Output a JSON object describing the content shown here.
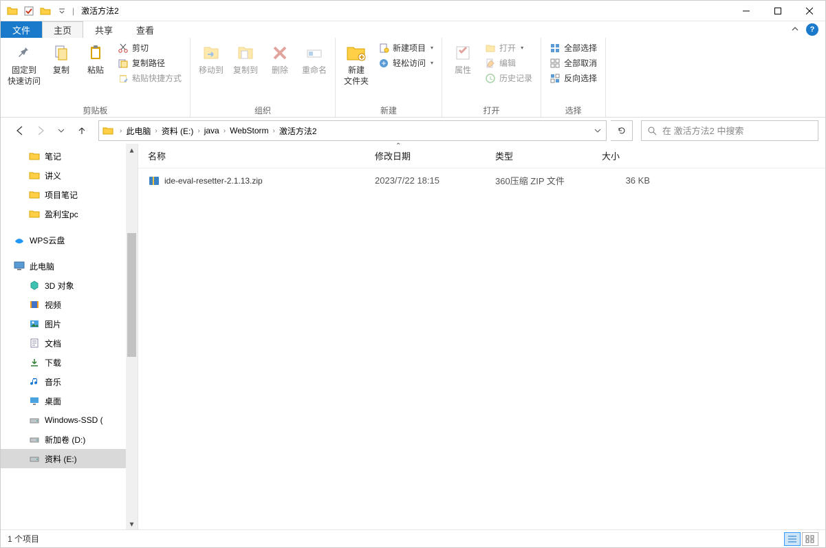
{
  "window": {
    "title": "激活方法2"
  },
  "tabs": {
    "file": "文件",
    "home": "主页",
    "share": "共享",
    "view": "查看"
  },
  "ribbon": {
    "clipboard": {
      "label": "剪贴板",
      "pin1": "固定到",
      "pin2": "快速访问",
      "copy": "复制",
      "paste": "粘贴",
      "cut": "剪切",
      "copypath": "复制路径",
      "pasteshort": "粘贴快捷方式"
    },
    "organize": {
      "label": "组织",
      "moveto": "移动到",
      "copyto": "复制到",
      "delete": "删除",
      "rename": "重命名"
    },
    "new": {
      "label": "新建",
      "folder1": "新建",
      "folder2": "文件夹",
      "newitem": "新建项目",
      "easyaccess": "轻松访问"
    },
    "open": {
      "label": "打开",
      "props": "属性",
      "open": "打开",
      "edit": "编辑",
      "history": "历史记录"
    },
    "select": {
      "label": "选择",
      "all": "全部选择",
      "none": "全部取消",
      "invert": "反向选择"
    }
  },
  "breadcrumb": {
    "items": [
      "此电脑",
      "资料 (E:)",
      "java",
      "WebStorm",
      "激活方法2"
    ]
  },
  "search": {
    "placeholder": "在 激活方法2 中搜索"
  },
  "tree": {
    "items": [
      {
        "label": "笔记",
        "icon": "folder",
        "level": 1
      },
      {
        "label": "讲义",
        "icon": "folder",
        "level": 1
      },
      {
        "label": "项目笔记",
        "icon": "folder",
        "level": 1
      },
      {
        "label": "盈利宝pc",
        "icon": "folder",
        "level": 1
      }
    ],
    "wps": "WPS云盘",
    "pc": "此电脑",
    "pcitems": [
      {
        "label": "3D 对象",
        "icon": "3d"
      },
      {
        "label": "视频",
        "icon": "video"
      },
      {
        "label": "图片",
        "icon": "pictures"
      },
      {
        "label": "文档",
        "icon": "docs"
      },
      {
        "label": "下载",
        "icon": "downloads"
      },
      {
        "label": "音乐",
        "icon": "music"
      },
      {
        "label": "桌面",
        "icon": "desktop"
      },
      {
        "label": "Windows-SSD (",
        "icon": "drive"
      },
      {
        "label": "新加卷 (D:)",
        "icon": "drive"
      },
      {
        "label": "资料 (E:)",
        "icon": "drive",
        "selected": true
      }
    ]
  },
  "columns": {
    "name": "名称",
    "date": "修改日期",
    "type": "类型",
    "size": "大小"
  },
  "files": [
    {
      "name": "ide-eval-resetter-2.1.13.zip",
      "date": "2023/7/22 18:15",
      "type": "360压缩 ZIP 文件",
      "size": "36 KB"
    }
  ],
  "status": {
    "items": "1 个项目"
  }
}
